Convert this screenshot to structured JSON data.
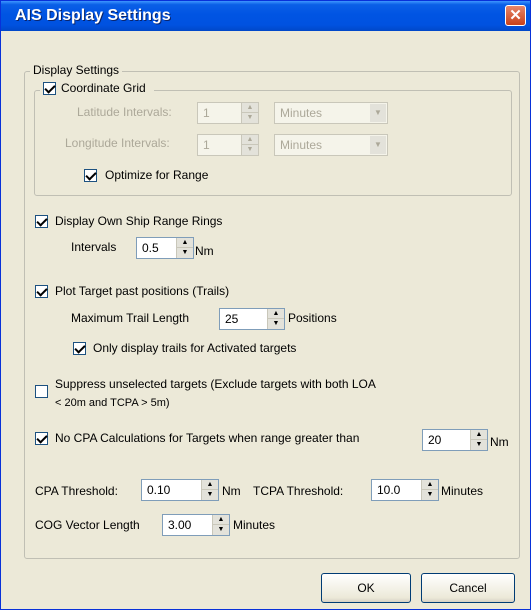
{
  "window": {
    "title": "AIS Display Settings",
    "close_glyph": "✕"
  },
  "display_group": {
    "legend": "Display Settings"
  },
  "coordinate_grid": {
    "legend": "Coordinate Grid",
    "checked": true,
    "latitude_label": "Latitude Intervals:",
    "latitude_value": "1",
    "latitude_unit": "Minutes",
    "longitude_label": "Longitude Intervals:",
    "longitude_value": "1",
    "longitude_unit": "Minutes",
    "optimize_label": "Optimize for Range",
    "optimize_checked": true
  },
  "range_rings": {
    "label": "Display Own Ship Range Rings",
    "checked": true,
    "intervals_label": "Intervals",
    "intervals_value": "0.5",
    "unit": "Nm"
  },
  "trails": {
    "label": "Plot Target past positions (Trails)",
    "checked": true,
    "max_length_label": "Maximum Trail Length",
    "max_length_value": "25",
    "unit": "Positions",
    "activated_only_label": "Only display trails for Activated targets",
    "activated_only_checked": true
  },
  "suppress": {
    "label_line1": "Suppress unselected targets (Exclude targets with both LOA",
    "label_line2": "< 20m and TCPA > 5m)",
    "checked": false
  },
  "no_cpa": {
    "label": "No CPA Calculations for Targets when range greater than",
    "checked": true,
    "value": "20",
    "unit": "Nm"
  },
  "cpa": {
    "label": "CPA Threshold:",
    "value": "0.10",
    "unit": "Nm"
  },
  "tcpa": {
    "label": "TCPA Threshold:",
    "value": "10.0",
    "unit": "Minutes"
  },
  "cog": {
    "label": "COG Vector Length",
    "value": "3.00",
    "unit": "Minutes"
  },
  "buttons": {
    "ok": "OK",
    "cancel": "Cancel"
  },
  "icons": {
    "spin_up": "▲",
    "spin_down": "▼",
    "combo_down": "▼"
  }
}
